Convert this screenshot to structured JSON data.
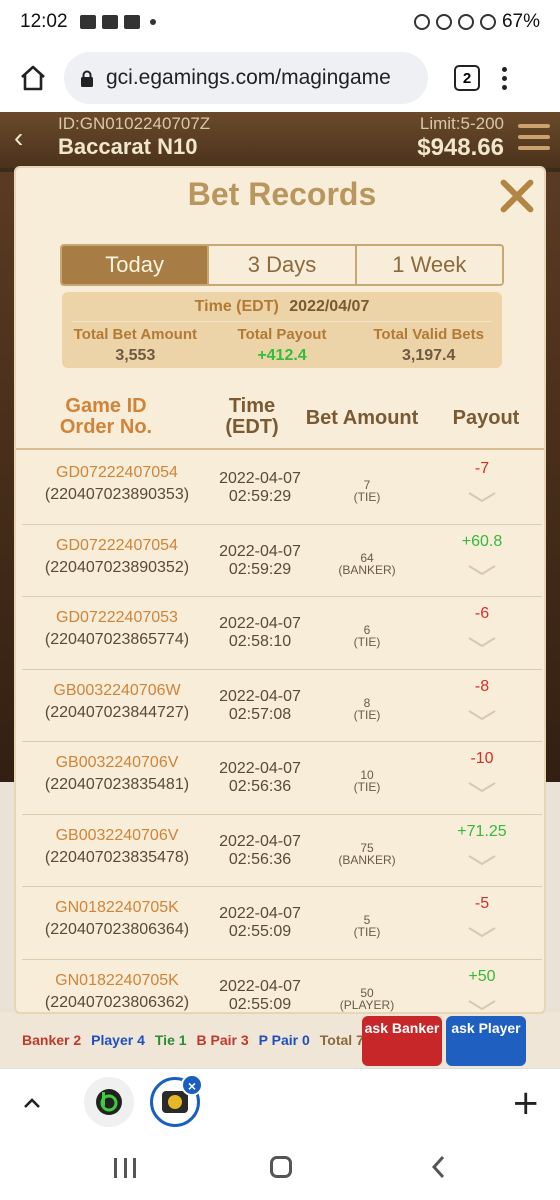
{
  "status_bar": {
    "time": "12:02",
    "battery": "67%"
  },
  "browser": {
    "url": "gci.egamings.com/magingame",
    "tab_count": "2"
  },
  "game": {
    "id_label": "ID:GN0102240707Z",
    "name": "Baccarat N10",
    "limit": "Limit:5-200",
    "balance": "$948.66",
    "stats": {
      "banker": "Banker 2",
      "player": "Player 4",
      "tie": "Tie 1",
      "bpair": "B Pair 3",
      "ppair": "P Pair 0",
      "total": "Total 7"
    },
    "ask_banker": "ask Banker",
    "ask_player": "ask Player"
  },
  "modal": {
    "title": "Bet Records",
    "tabs": [
      "Today",
      "3 Days",
      "1 Week"
    ],
    "active_tab": "Today",
    "summary": {
      "time_label": "Time (EDT)",
      "date": "2022/04/07",
      "total_bet_label": "Total Bet Amount",
      "total_bet": "3,553",
      "total_payout_label": "Total Payout",
      "total_payout": "+412.4",
      "total_valid_label": "Total Valid Bets",
      "total_valid": "3,197.4"
    },
    "headers": {
      "game_id": "Game ID",
      "order_no": "Order No.",
      "time": "Time",
      "time_zone": "(EDT)",
      "bet_amount": "Bet Amount",
      "payout": "Payout"
    },
    "rows": [
      {
        "game_id": "GD07222407054",
        "order": "(220407023890353)",
        "date": "2022-04-07",
        "time": "02:59:29",
        "amount": "7",
        "type": "(TIE)",
        "payout": "-7",
        "sign": "neg"
      },
      {
        "game_id": "GD07222407054",
        "order": "(220407023890352)",
        "date": "2022-04-07",
        "time": "02:59:29",
        "amount": "64",
        "type": "(BANKER)",
        "payout": "+60.8",
        "sign": "pos"
      },
      {
        "game_id": "GD07222407053",
        "order": "(220407023865774)",
        "date": "2022-04-07",
        "time": "02:58:10",
        "amount": "6",
        "type": "(TIE)",
        "payout": "-6",
        "sign": "neg"
      },
      {
        "game_id": "GB0032240706W",
        "order": "(220407023844727)",
        "date": "2022-04-07",
        "time": "02:57:08",
        "amount": "8",
        "type": "(TIE)",
        "payout": "-8",
        "sign": "neg"
      },
      {
        "game_id": "GB0032240706V",
        "order": "(220407023835481)",
        "date": "2022-04-07",
        "time": "02:56:36",
        "amount": "10",
        "type": "(TIE)",
        "payout": "-10",
        "sign": "neg"
      },
      {
        "game_id": "GB0032240706V",
        "order": "(220407023835478)",
        "date": "2022-04-07",
        "time": "02:56:36",
        "amount": "75",
        "type": "(BANKER)",
        "payout": "+71.25",
        "sign": "pos"
      },
      {
        "game_id": "GN0182240705K",
        "order": "(220407023806364)",
        "date": "2022-04-07",
        "time": "02:55:09",
        "amount": "5",
        "type": "(TIE)",
        "payout": "-5",
        "sign": "neg"
      },
      {
        "game_id": "GN0182240705K",
        "order": "(220407023806362)",
        "date": "2022-04-07",
        "time": "02:55:09",
        "amount": "50",
        "type": "(PLAYER)",
        "payout": "+50",
        "sign": "pos"
      }
    ]
  },
  "colors": {
    "accent": "#b8965e",
    "active_tab": "#a77c45",
    "negative": "#d0302a",
    "positive": "#37b83b"
  },
  "icons": {
    "home": "home-icon",
    "lock": "lock-icon",
    "close": "close-icon",
    "chevron": "chevron-down-icon"
  }
}
